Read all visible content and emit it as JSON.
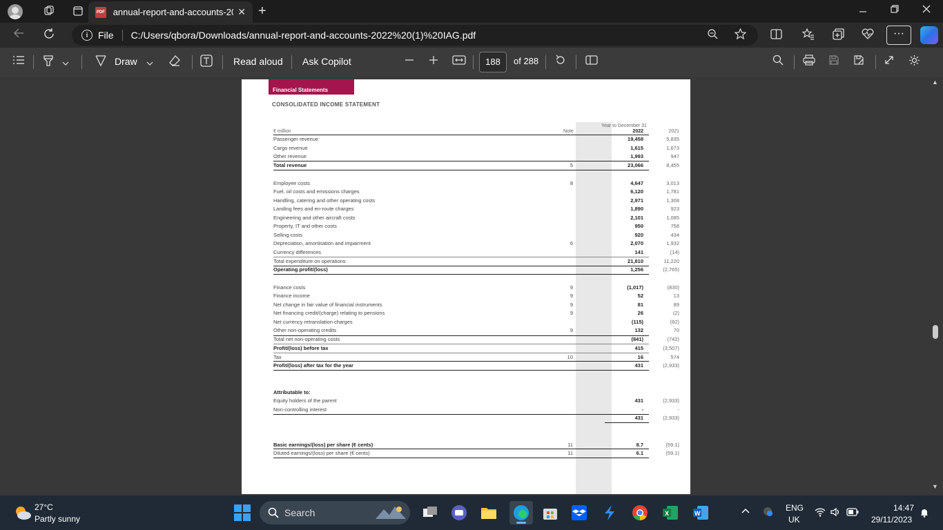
{
  "browser": {
    "tab_title": "annual-report-and-accounts-202",
    "tab_close": "✕",
    "new_tab": "+",
    "file_label": "File",
    "url": "C:/Users/qbora/Downloads/annual-report-and-accounts-2022%20(1)%20IAG.pdf",
    "more": "···"
  },
  "pdf_toolbar": {
    "draw": "Draw",
    "read_aloud": "Read aloud",
    "ask_copilot": "Ask Copilot",
    "page_current": "188",
    "page_total": "of 288"
  },
  "document": {
    "section_band": "Financial Statements",
    "statement_title": "CONSOLIDATED INCOME STATEMENT",
    "header_unit": "€ million",
    "header_note": "Note",
    "header_period": "Year to December 31",
    "header_2022": "2022",
    "header_2021": "2021",
    "rows": [
      {
        "label": "Passenger revenue",
        "note": "",
        "v2022": "19,458",
        "v2021": "5,835"
      },
      {
        "label": "Cargo revenue",
        "note": "",
        "v2022": "1,615",
        "v2021": "1,673"
      },
      {
        "label": "Other revenue",
        "note": "",
        "v2022": "1,993",
        "v2021": "947"
      },
      {
        "label": "Total revenue",
        "note": "5",
        "v2022": "23,066",
        "v2021": "8,455"
      },
      {
        "label": "Employee costs",
        "note": "8",
        "v2022": "4,647",
        "v2021": "3,013"
      },
      {
        "label": "Fuel, oil costs and emissions charges",
        "note": "",
        "v2022": "6,120",
        "v2021": "1,781"
      },
      {
        "label": "Handling, catering and other operating costs",
        "note": "",
        "v2022": "2,971",
        "v2021": "1,308"
      },
      {
        "label": "Landing fees and en-route charges",
        "note": "",
        "v2022": "1,890",
        "v2021": "923"
      },
      {
        "label": "Engineering and other aircraft costs",
        "note": "",
        "v2022": "2,101",
        "v2021": "1,085"
      },
      {
        "label": "Property, IT and other costs",
        "note": "",
        "v2022": "950",
        "v2021": "758"
      },
      {
        "label": "Selling costs",
        "note": "",
        "v2022": "920",
        "v2021": "434"
      },
      {
        "label": "Depreciation, amortisation and impairment",
        "note": "6",
        "v2022": "2,070",
        "v2021": "1,932"
      },
      {
        "label": "Currency differences",
        "note": "",
        "v2022": "141",
        "v2021": "(14)"
      },
      {
        "label": "Total expenditure on operations",
        "note": "",
        "v2022": "21,810",
        "v2021": "11,220"
      },
      {
        "label": "Operating profit/(loss)",
        "note": "",
        "v2022": "1,256",
        "v2021": "(2,765)"
      },
      {
        "label": "Finance costs",
        "note": "9",
        "v2022": "(1,017)",
        "v2021": "(830)"
      },
      {
        "label": "Finance income",
        "note": "9",
        "v2022": "52",
        "v2021": "13"
      },
      {
        "label": "Net change in fair value of financial instruments",
        "note": "9",
        "v2022": "81",
        "v2021": "89"
      },
      {
        "label": "Net financing credit/(charge) relating to pensions",
        "note": "9",
        "v2022": "26",
        "v2021": "(2)"
      },
      {
        "label": "Net currency retranslation charges",
        "note": "",
        "v2022": "(115)",
        "v2021": "(82)"
      },
      {
        "label": "Other non-operating credits",
        "note": "9",
        "v2022": "132",
        "v2021": "70"
      },
      {
        "label": "Total net non-operating costs",
        "note": "",
        "v2022": "(841)",
        "v2021": "(742)"
      },
      {
        "label": "Profit/(loss) before tax",
        "note": "",
        "v2022": "415",
        "v2021": "(3,507)"
      },
      {
        "label": "Tax",
        "note": "10",
        "v2022": "16",
        "v2021": "574"
      },
      {
        "label": "Profit/(loss) after tax for the year",
        "note": "",
        "v2022": "431",
        "v2021": "(2,933)"
      },
      {
        "label": "Attributable to:",
        "note": "",
        "v2022": "",
        "v2021": ""
      },
      {
        "label": "Equity holders of the parent",
        "note": "",
        "v2022": "431",
        "v2021": "(2,933)"
      },
      {
        "label": "Non-controlling interest",
        "note": "",
        "v2022": "-",
        "v2021": "-"
      },
      {
        "label": "",
        "note": "",
        "v2022": "431",
        "v2021": "(2,933)"
      },
      {
        "label": "Basic earnings/(loss) per share (€ cents)",
        "note": "11",
        "v2022": "8.7",
        "v2021": "(59.1)"
      },
      {
        "label": "Diluted earnings/(loss) per share (€ cents)",
        "note": "11",
        "v2022": "6.1",
        "v2021": "(59.1)"
      }
    ]
  },
  "taskbar": {
    "temperature": "27°C",
    "weather": "Partly sunny",
    "search": "Search",
    "lang": "ENG",
    "region": "UK",
    "time": "14:47",
    "date": "29/11/2023"
  }
}
